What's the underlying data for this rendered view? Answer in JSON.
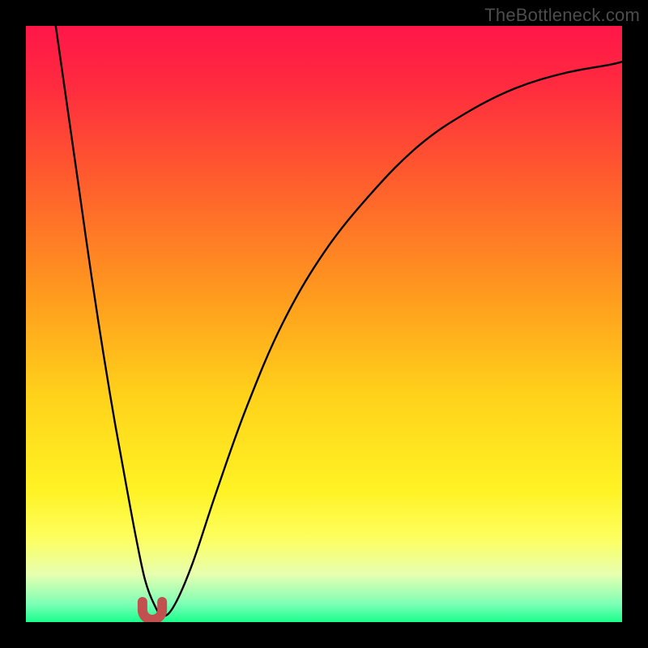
{
  "watermark": "TheBottleneck.com",
  "colors": {
    "frame": "#000000",
    "watermark": "#4d4d4d",
    "curve_stroke": "#000000",
    "marker_fill": "#c1504f",
    "gradient_stops": [
      {
        "offset": 0.0,
        "color": "#ff1649"
      },
      {
        "offset": 0.1,
        "color": "#ff2b3f"
      },
      {
        "offset": 0.25,
        "color": "#ff5a2e"
      },
      {
        "offset": 0.45,
        "color": "#ff9a1e"
      },
      {
        "offset": 0.62,
        "color": "#ffd21a"
      },
      {
        "offset": 0.78,
        "color": "#fff324"
      },
      {
        "offset": 0.86,
        "color": "#fdff60"
      },
      {
        "offset": 0.92,
        "color": "#e7ffb0"
      },
      {
        "offset": 0.97,
        "color": "#7cffb6"
      },
      {
        "offset": 1.0,
        "color": "#18ff8c"
      }
    ]
  },
  "chart_data": {
    "type": "line",
    "title": "",
    "xlabel": "",
    "ylabel": "",
    "xlim": [
      0,
      100
    ],
    "ylim": [
      0,
      100
    ],
    "grid": false,
    "legend": false,
    "series": [
      {
        "name": "bottleneck-curve",
        "x": [
          5,
          7,
          9,
          11,
          13,
          15,
          17,
          18.5,
          20,
          21.5,
          23,
          25,
          28,
          32,
          37,
          43,
          50,
          58,
          66,
          74,
          82,
          90,
          98,
          100
        ],
        "y": [
          100,
          86,
          72,
          58,
          45,
          33,
          22,
          14,
          7,
          3,
          1,
          3,
          10,
          22,
          36,
          50,
          62,
          72,
          80,
          85.5,
          89.5,
          92,
          93.5,
          94
        ]
      }
    ],
    "marker": {
      "name": "optimum-u-marker",
      "x_center": 21.2,
      "y_bottom": 0.4,
      "width": 3.3,
      "height": 3.0,
      "shape": "u"
    },
    "annotations": []
  }
}
